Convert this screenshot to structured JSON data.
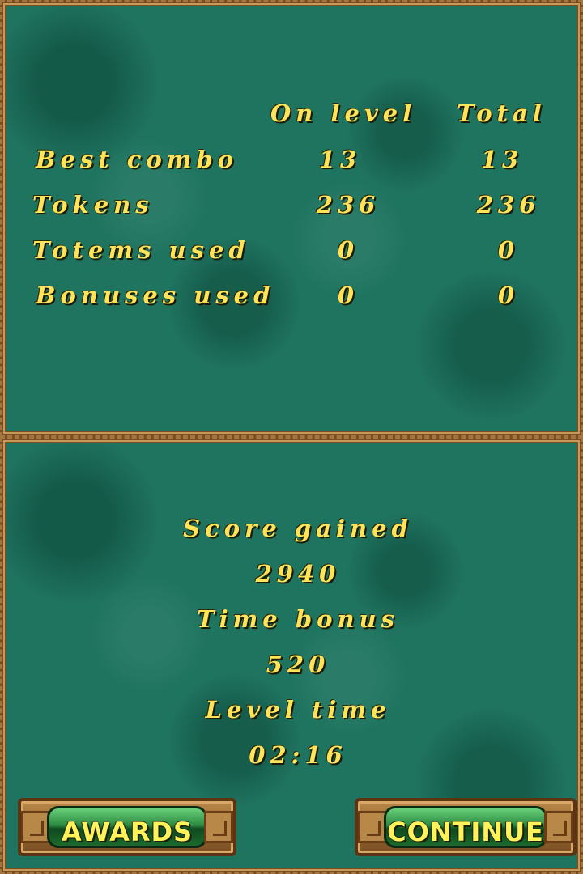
{
  "stats": {
    "headers": {
      "on_level": "On level",
      "total": "Total"
    },
    "rows": [
      {
        "label": "Best combo",
        "on_level": "13",
        "total": "13"
      },
      {
        "label": "Tokens",
        "on_level": "236",
        "total": "236"
      },
      {
        "label": "Totems used",
        "on_level": "0",
        "total": "0"
      },
      {
        "label": "Bonuses used",
        "on_level": "0",
        "total": "0"
      }
    ]
  },
  "summary": {
    "score_gained_label": "Score gained",
    "score_gained_value": "2940",
    "time_bonus_label": "Time bonus",
    "time_bonus_value": "520",
    "level_time_label": "Level time",
    "level_time_value": "02:16"
  },
  "buttons": {
    "awards": "AWARDS",
    "continue": "CONTINUE"
  },
  "colors": {
    "panel_green": "#1f7460",
    "frame_brown": "#7a4e22",
    "text_yellow": "#ffe45a",
    "button_green": "#2b8a40"
  }
}
